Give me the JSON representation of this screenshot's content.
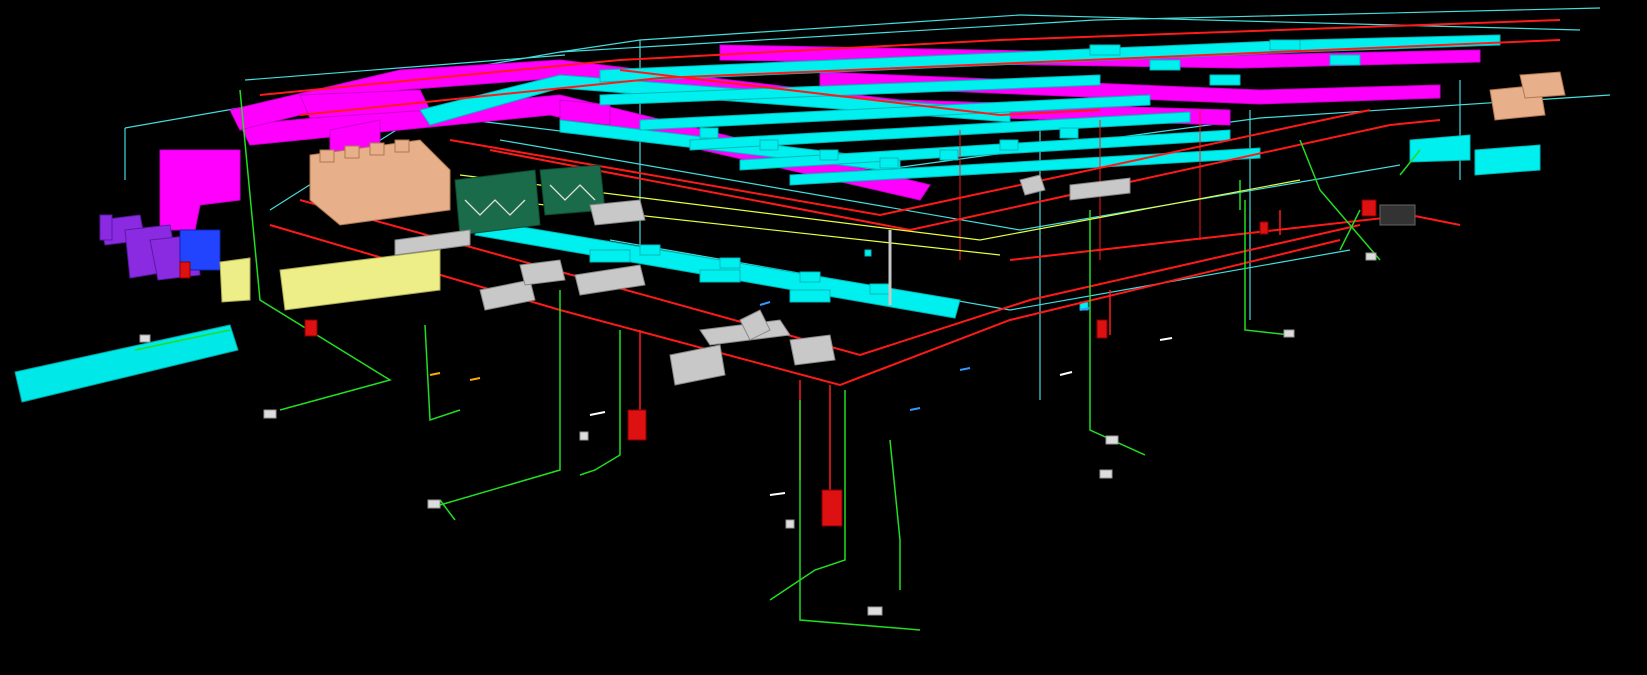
{
  "colors": {
    "background": "#000000",
    "duct_supply": "#00f0f0",
    "duct_return": "#ff00ff",
    "piping_fire": "#ff1a1a",
    "piping_plumbing": "#22dd22",
    "piping_gas": "#e8ff40",
    "equipment_exhaust": "#8a2be2",
    "equipment_chiller": "#1a6b4a",
    "equipment_ahu": "#eeee88",
    "equipment_cooling_tower": "#e8b08a",
    "equipment_grey": "#c8c8c8",
    "equipment_blue": "#2244ff"
  },
  "scene": {
    "view": "3d-perspective",
    "content": "mep-coordination-model",
    "systems": [
      {
        "key": "duct_supply",
        "icon": "supply-duct"
      },
      {
        "key": "duct_return",
        "icon": "return-duct"
      },
      {
        "key": "piping_fire",
        "icon": "fire-pipe"
      },
      {
        "key": "piping_plumbing",
        "icon": "plumbing-pipe"
      },
      {
        "key": "piping_gas",
        "icon": "gas-pipe"
      }
    ]
  }
}
